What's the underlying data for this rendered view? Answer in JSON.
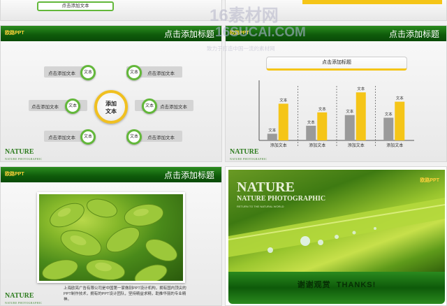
{
  "watermark": {
    "brand": "16素材网",
    "domain": "16SUCAI.COM",
    "slogan": "致力于打造中国一流的素材网"
  },
  "top_left_slide": {
    "title_bar_text": "点击添加文本"
  },
  "slide_common": {
    "logo_text": "欧路PPT",
    "title": "点击添加标题"
  },
  "nature_mark": {
    "title": "NATURE",
    "subtitle": "NATURE PHOTOGRAPHIC"
  },
  "diagram_slide": {
    "hub_label": "添加\n文本",
    "node_label": "文本",
    "items": [
      "点击添加文本",
      "点击添加文本",
      "点击添加文本",
      "点击添加文本",
      "点击添加文本",
      "点击添加文本"
    ]
  },
  "chart_slide": {
    "chart_data": {
      "type": "bar",
      "title": "点击添加标题",
      "categories": [
        "添加文本",
        "添加文本",
        "添加文本",
        "添加文本"
      ],
      "series": [
        {
          "values": [
            1,
            2.2,
            3.8,
            3.4
          ],
          "color": "#9a9a9a"
        },
        {
          "values": [
            5.5,
            4.2,
            7.2,
            5.8
          ],
          "color": "#f5c518"
        }
      ],
      "data_label": "文本",
      "ylim": [
        0,
        9
      ],
      "grid": "dashed-vertical-dividers"
    }
  },
  "photo_slide": {
    "caption": "上海欧亮广告有限公司是中国第一家做别PPT设计机构，拥有国内顶尖的PPT制作技术，拥有的PPT设计团队，坚持精益求精，助推华丽的专业精神。"
  },
  "end_slide": {
    "nature_title": "NATURE",
    "nature_subtitle": "NATURE PHOTOGRAPHIC",
    "nature_tag": "RETURN TO THE NATURAL WORLD",
    "thanks_text": "谢谢观赏  THANKS!"
  },
  "colors": {
    "green_dark": "#0e5a0a",
    "green": "#2b8c1f",
    "yellow": "#f5c518",
    "gray": "#9a9a9a"
  }
}
